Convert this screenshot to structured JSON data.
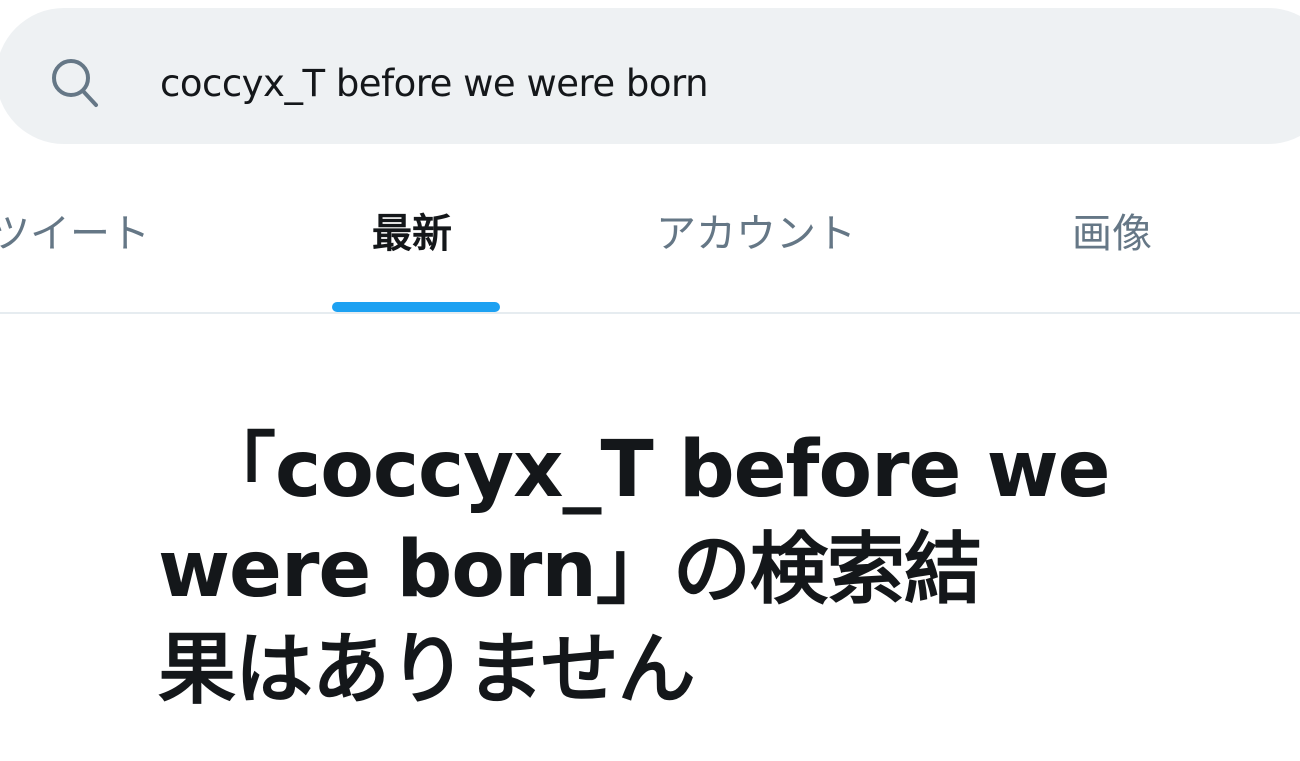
{
  "search": {
    "value": "coccyx_T before we were born",
    "icon": "search-icon"
  },
  "tabs": [
    {
      "label": "ツイート",
      "active": false
    },
    {
      "label": "最新",
      "active": true
    },
    {
      "label": "アカウント",
      "active": false
    },
    {
      "label": "画像",
      "active": false
    }
  ],
  "colors": {
    "accent": "#1da1f2",
    "search_bg": "#eef1f3",
    "text_primary": "#14171a",
    "text_secondary": "#657786"
  },
  "empty_state": {
    "line1": "「coccyx_T before we",
    "line2": "were born」の検索結",
    "line3": "果はありません"
  }
}
